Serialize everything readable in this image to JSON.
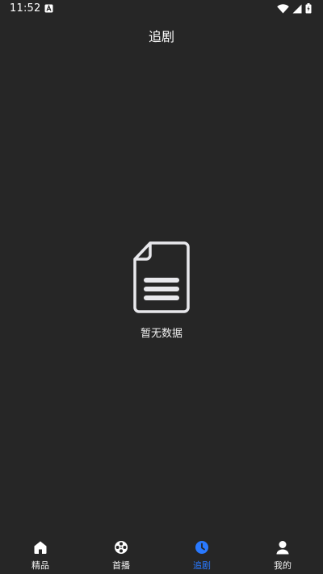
{
  "status_bar": {
    "time": "11:52"
  },
  "header": {
    "title": "追剧"
  },
  "empty_state": {
    "icon": "document-icon",
    "message": "暂无数据"
  },
  "bottom_nav": {
    "items": [
      {
        "label": "精品",
        "icon": "home-icon",
        "active": false
      },
      {
        "label": "首播",
        "icon": "film-reel-icon",
        "active": false
      },
      {
        "label": "追剧",
        "icon": "clock-icon",
        "active": true
      },
      {
        "label": "我的",
        "icon": "user-icon",
        "active": false
      }
    ],
    "active_color": "#2979ff",
    "inactive_color": "#ffffff"
  },
  "colors": {
    "background": "#262626"
  }
}
